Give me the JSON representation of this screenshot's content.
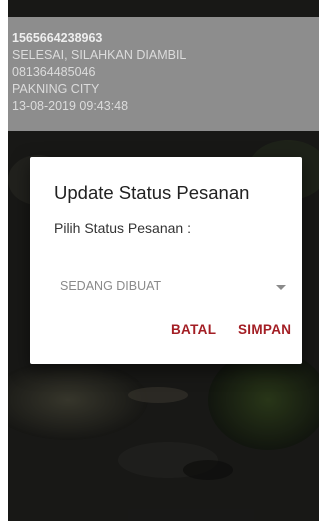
{
  "order_card": {
    "order_id": "1565664238963",
    "status": "SELESAI, SILAHKAN DIAMBIL",
    "phone": "081364485046",
    "city": "PAKNING CITY",
    "datetime": "13-08-2019 09:43:48"
  },
  "dialog": {
    "title": "Update Status Pesanan",
    "subtitle": "Pilih Status Pesanan :",
    "selected_status": "SEDANG DIBUAT",
    "cancel_label": "BATAL",
    "save_label": "SIMPAN"
  },
  "colors": {
    "accent": "#a31e24",
    "card_bg": "#8d8d8d",
    "scrim": "rgba(0,0,0,0.42)"
  },
  "icons": {
    "dropdown": "triangle-down-icon"
  }
}
